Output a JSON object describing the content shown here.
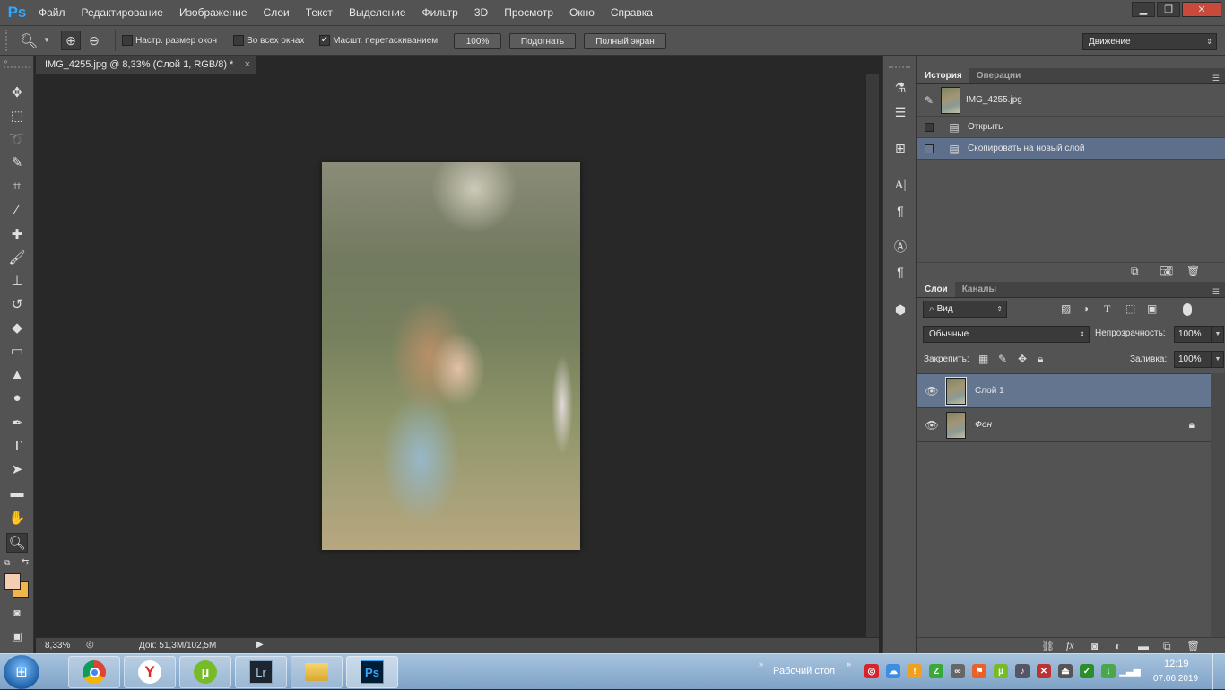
{
  "app": {
    "logo": "Ps"
  },
  "menu": [
    "Файл",
    "Редактирование",
    "Изображение",
    "Слои",
    "Текст",
    "Выделение",
    "Фильтр",
    "3D",
    "Просмотр",
    "Окно",
    "Справка"
  ],
  "window_controls": {
    "minimize": "▁",
    "restore": "❐",
    "close": "✕"
  },
  "options": {
    "resize_windows": "Настр. размер окон",
    "all_windows": "Во всех окнах",
    "scrubby_zoom": "Масшт. перетаскиванием",
    "scrubby_checked": true,
    "btn_100": "100%",
    "btn_fit": "Подогнать",
    "btn_fullscreen": "Полный экран",
    "workspace": "Движение"
  },
  "document": {
    "tab_title": "IMG_4255.jpg @ 8,33% (Слой 1, RGB/8) *",
    "close": "×",
    "zoom": "8,33%",
    "doc_info": "Док: 51,3M/102,5M"
  },
  "colors": {
    "foreground": "#f4cdb3",
    "background": "#f3b44a",
    "history_selected": "#5d6f8a",
    "layer_selected": "#64758f"
  },
  "history": {
    "tabs": [
      "История",
      "Операции"
    ],
    "snapshot": "IMG_4255.jpg",
    "items": [
      {
        "label": "Открыть",
        "selected": false
      },
      {
        "label": "Скопировать на новый слой",
        "selected": true
      }
    ]
  },
  "layers": {
    "tabs": [
      "Слои",
      "Каналы"
    ],
    "filter": "Вид",
    "blend_mode": "Обычные",
    "opacity_label": "Непрозрачность:",
    "opacity": "100%",
    "lock_label": "Закрепить:",
    "fill_label": "Заливка:",
    "fill": "100%",
    "items": [
      {
        "name": "Слой 1",
        "selected": true,
        "locked": false
      },
      {
        "name": "Фон",
        "selected": false,
        "locked": true
      }
    ]
  },
  "taskbar": {
    "apps": [
      "Chrome",
      "Yandex",
      "uTorrent",
      "Lr",
      "Folder",
      "Ps"
    ],
    "desktop_label": "Рабочий стол",
    "time": "12:19",
    "date": "07.06.2019"
  }
}
